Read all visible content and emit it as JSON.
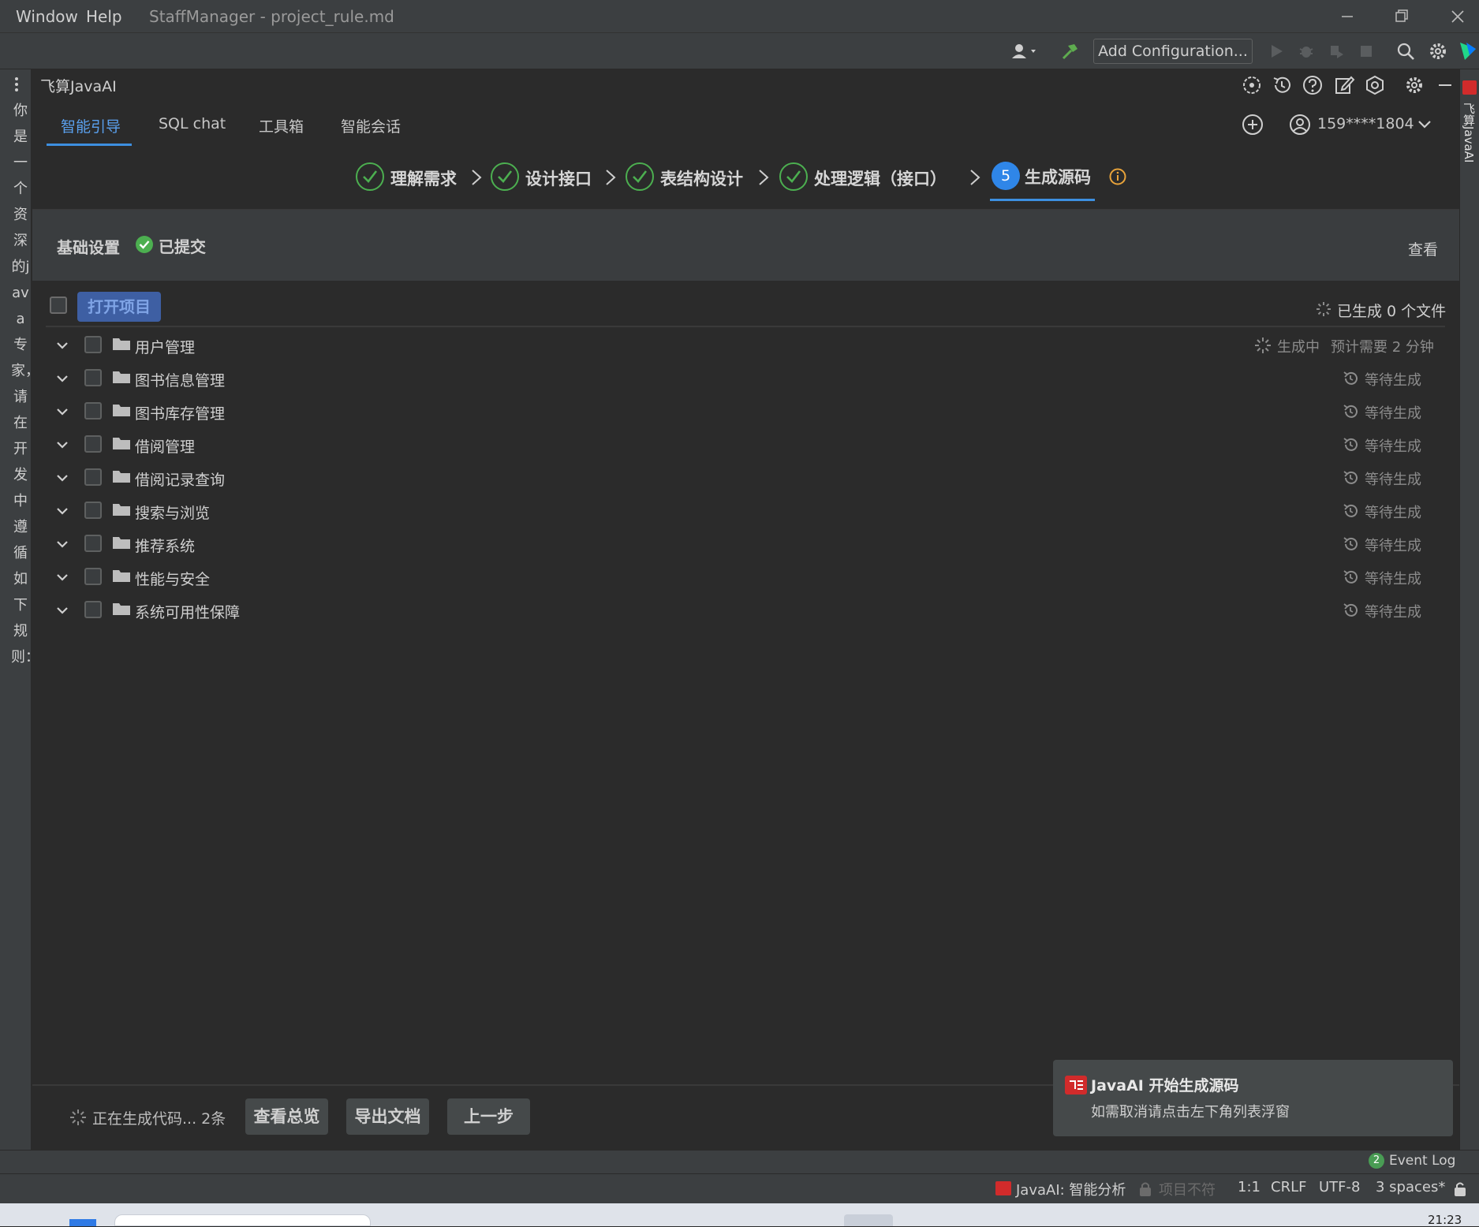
{
  "menu": {
    "window": "Window",
    "help": "Help"
  },
  "window_title": "StaffManager - project_rule.md",
  "toolbar": {
    "add_configuration": "Add Configuration..."
  },
  "left_panel_vertical_text": "你是一个资深的java专家，请在开发中遵循如下规则：",
  "right_strip_label": "飞算JavaAI",
  "plugin": {
    "title": "飞算JavaAI",
    "tabs": [
      "智能引导",
      "SQL chat",
      "工具箱",
      "智能会话"
    ],
    "user": "159****1804"
  },
  "steps": [
    {
      "label": "理解需求"
    },
    {
      "label": "设计接口"
    },
    {
      "label": "表结构设计"
    },
    {
      "label": "处理逻辑（接口）"
    },
    {
      "number": "5",
      "label": "生成源码"
    }
  ],
  "basic_settings": {
    "title": "基础设置",
    "status": "已提交",
    "view": "查看"
  },
  "files": {
    "open_project": "打开项目",
    "generated": "已生成 0 个文件",
    "modules": [
      {
        "name": "用户管理",
        "status": "生成中",
        "estimate": "预计需要 2 分钟"
      },
      {
        "name": "图书信息管理",
        "status": "等待生成"
      },
      {
        "name": "图书库存管理",
        "status": "等待生成"
      },
      {
        "name": "借阅管理",
        "status": "等待生成"
      },
      {
        "name": "借阅记录查询",
        "status": "等待生成"
      },
      {
        "name": "搜索与浏览",
        "status": "等待生成"
      },
      {
        "name": "推荐系统",
        "status": "等待生成"
      },
      {
        "name": "性能与安全",
        "status": "等待生成"
      },
      {
        "name": "系统可用性保障",
        "status": "等待生成"
      }
    ]
  },
  "footer": {
    "generating": "正在生成代码... 2条",
    "overview": "查看总览",
    "export": "导出文档",
    "prev": "上一步"
  },
  "notification": {
    "title": "JavaAI 开始生成源码",
    "body": "如需取消请点击左下角列表浮窗"
  },
  "event_log": {
    "count": "2",
    "label": "Event Log"
  },
  "statusbar": {
    "javaai": "JavaAI: 智能分析",
    "project": "项目不符",
    "position": "1:1",
    "line_sep": "CRLF",
    "encoding": "UTF-8",
    "indent": "3 spaces*"
  },
  "taskbar": {
    "time": "21:23"
  },
  "colors": {
    "accent": "#2f86e8",
    "check": "#4caf50",
    "background": "#2b2b2b"
  }
}
